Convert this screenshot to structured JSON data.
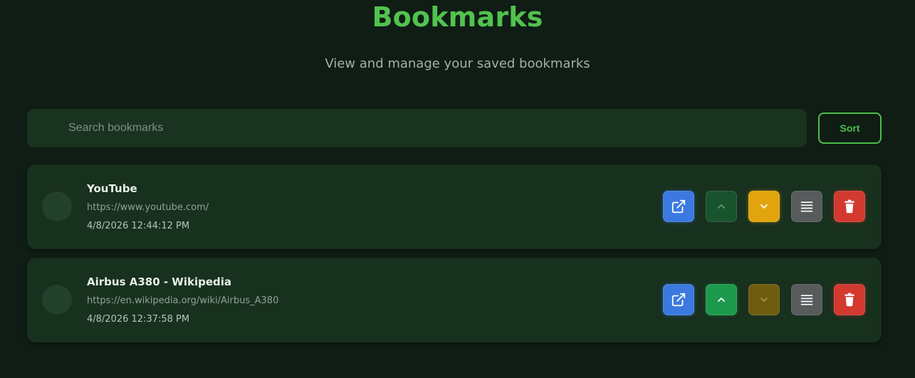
{
  "header": {
    "title": "Bookmarks",
    "subtitle": "View and manage your saved bookmarks"
  },
  "search": {
    "placeholder": "Search bookmarks",
    "value": ""
  },
  "toolbar": {
    "sort_label": "Sort"
  },
  "bookmarks": [
    {
      "title": "YouTube",
      "url": "https://www.youtube.com/",
      "date": "4/8/2026 12:44:12 PM",
      "move_up_enabled": false,
      "move_down_enabled": true
    },
    {
      "title": "Airbus A380 - Wikipedia",
      "url": "https://en.wikipedia.org/wiki/Airbus_A380",
      "date": "4/8/2026 12:37:58 PM",
      "move_up_enabled": true,
      "move_down_enabled": false
    }
  ],
  "icons": {
    "open": "external-link-icon",
    "move_up": "chevron-up-icon",
    "move_down": "chevron-down-icon",
    "details": "menu-lines-icon",
    "delete": "trash-icon"
  },
  "colors": {
    "background": "#0f1d14",
    "accent": "#52c24f",
    "card": "#18301e",
    "open": "#3b79e0",
    "move_up_active": "#1d9a4c",
    "move_down_active": "#e2a40d",
    "details": "#575b5c",
    "delete": "#d2392f"
  }
}
